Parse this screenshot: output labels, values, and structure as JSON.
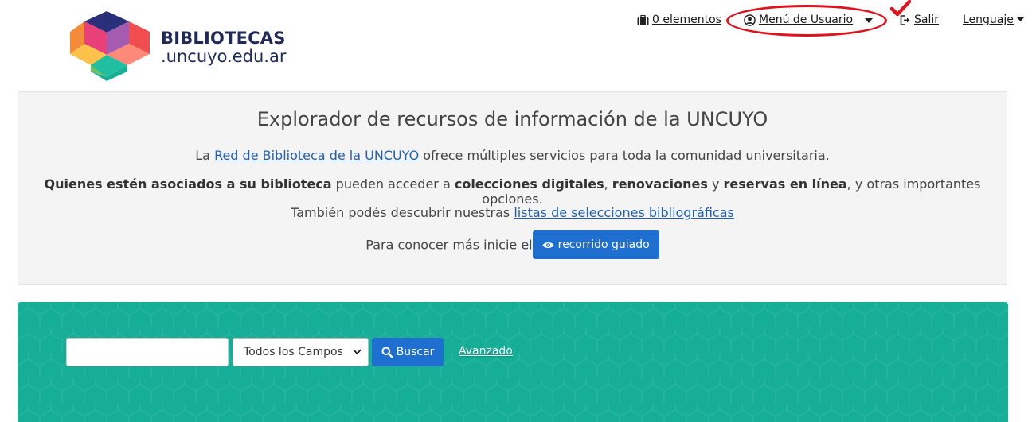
{
  "header": {
    "logo": {
      "line1": "BIBLIOTECAS",
      "line2": ".uncuyo.edu.ar"
    },
    "nav": {
      "cart_label": "0 elementos",
      "user_menu_label": "Menú de Usuario",
      "logout_label": "Salir",
      "language_label": "Lenguaje"
    }
  },
  "intro": {
    "title": "Explorador de recursos de información de la UNCUYO",
    "line1": {
      "pre": "La ",
      "link": "Red de Biblioteca de la UNCUYO",
      "post": " ofrece múltiples servicios para toda la comunidad universitaria."
    },
    "line2": {
      "b1": "Quienes estén asociados a su biblioteca",
      "t1": " pueden acceder a ",
      "b2": "colecciones digitales",
      "t2": ", ",
      "b3": "renovaciones",
      "t3": " y ",
      "b4": "reservas en línea",
      "t4": ", y otras importantes opciones."
    },
    "line3": {
      "pre": "También podés descubrir nuestras ",
      "link": "listas de selecciones bibliográficas"
    },
    "line4": {
      "pre": "Para conocer más inicie el",
      "button": "recorrido guiado"
    }
  },
  "search": {
    "input_value": "",
    "input_placeholder": "",
    "field_selected": "Todos los Campos",
    "button_label": "Buscar",
    "advanced_label": "Avanzado"
  },
  "colors": {
    "accent_blue": "#1e6fd0",
    "band_teal": "#16ae97",
    "annotation_red": "#e0121e"
  },
  "icons": [
    "suitcase-icon",
    "user-circle-icon",
    "caret-down-icon",
    "sign-out-icon",
    "eye-icon",
    "search-icon",
    "checkmark-icon"
  ]
}
